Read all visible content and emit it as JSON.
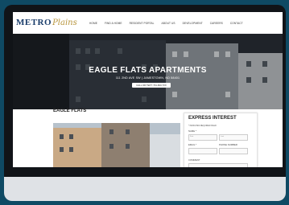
{
  "nav": {
    "logo_metro": "METRO",
    "logo_plains": "Plains",
    "items": [
      "HOME",
      "FIND A HOME",
      "RESIDENT PORTAL",
      "ABOUT US",
      "DEVELOPMENT",
      "CAREERS",
      "CONTACT"
    ]
  },
  "hero": {
    "title": "EAGLE FLATS APARTMENTS",
    "address": "111 2ND AVE SW | JAMESTOWN, ND 58401",
    "cta_label": "CALL OR TEXT: 701-663-7XX"
  },
  "main": {
    "section_title": "EAGLE FLATS"
  },
  "form": {
    "title": "EXPRESS INTEREST",
    "required_note": "* INDICATES REQUIRED FIELD",
    "name_label": "NAME *",
    "first_hint": "First",
    "last_hint": "Last",
    "email_label": "EMAIL *",
    "phone_label": "PHONE NUMBER",
    "comment_label": "COMMENT"
  },
  "colors": {
    "background": "#0f4a64",
    "device_frame": "#111418",
    "logo_navy": "#1a3d6b",
    "logo_gold": "#b8963e"
  }
}
